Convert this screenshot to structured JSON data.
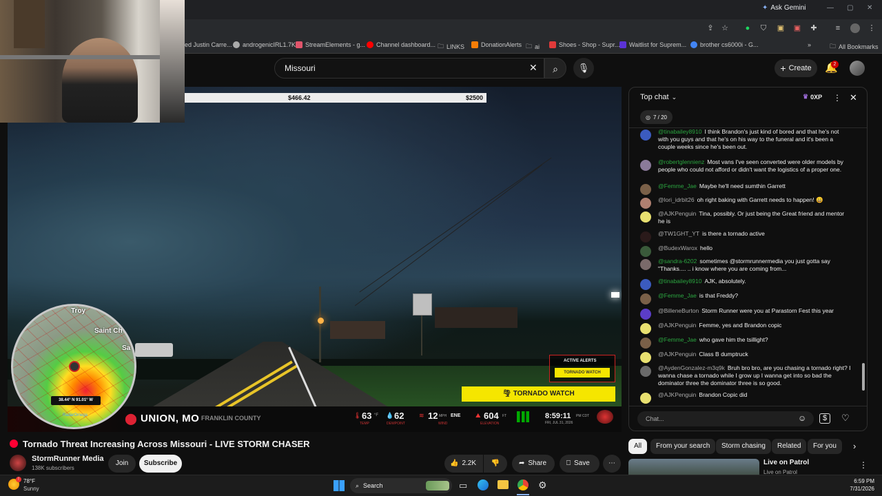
{
  "browser": {
    "ask_gemini": "Ask Gemini",
    "bookmarks": [
      {
        "label": "ed Justin Carre...",
        "color": "#888"
      },
      {
        "label": "androgenicIRL1.7K",
        "color": "#aaa"
      },
      {
        "label": "StreamElements - g...",
        "color": "#e0556b"
      },
      {
        "label": "Channel dashboard...",
        "color": "#ff0000"
      },
      {
        "label": "LINKS",
        "color": "#c8c8c8"
      },
      {
        "label": "DonationAlerts",
        "color": "#f57d07"
      },
      {
        "label": "ai",
        "color": "#c8c8c8"
      },
      {
        "label": "Shoes - Shop - Supr...",
        "color": "#e03a3a"
      },
      {
        "label": "Waitlist for Suprem...",
        "color": "#5b33d6"
      },
      {
        "label": "brother cs6000i - G...",
        "color": "#4285f4"
      }
    ],
    "all_bookmarks": "All Bookmarks"
  },
  "youtube": {
    "search_value": "Missouri",
    "create_label": "Create",
    "notif_count": "2"
  },
  "video": {
    "donation_current": "$466.42",
    "donation_goal": "$2500",
    "location": "UNION, MO",
    "county": "FRANKLIN COUNTY",
    "temp": "63",
    "temp_unit": "°F",
    "temp_label": "TEMP",
    "dewpoint": "62",
    "dewpoint_label": "DEWPOINT",
    "wind": "12",
    "wind_unit": "MPH",
    "wind_dir": "ENE",
    "wind_label": "WIND",
    "elevation": "604",
    "elevation_unit": "FT",
    "elevation_label": "ELEVATION",
    "time": "8:59:11",
    "time_zone": "PM CDT",
    "date": "FRI, JUL 31, 2026",
    "active_alerts": "ACTIVE ALERTS",
    "alert_small": "TORNADO WATCH",
    "alert_banner": "TORNADO WATCH",
    "radar_coords": "38.44° N 91.01° W",
    "radar_brand": "RadarOmega",
    "radar_town1": "Troy",
    "radar_town2": "Saint Ch",
    "radar_town3": "Sa"
  },
  "video_info": {
    "title": "Tornado Threat Increasing Across Missouri - LIVE STORM CHASER",
    "channel": "StormRunner Media",
    "subscribers": "138K subscribers",
    "join": "Join",
    "subscribe": "Subscribe",
    "likes": "2.2K",
    "share": "Share",
    "save": "Save"
  },
  "chat": {
    "header": "Top chat",
    "xp": "0XP",
    "progress": "7 / 20",
    "input_placeholder": "Chat...",
    "messages": [
      {
        "author": "@tinabailey8910",
        "text": "I think Brandon's just kind of bored and that he's not with you guys and that he's on his way to the funeral and it's been a couple weeks since he's been out.",
        "green": true,
        "avatar": "#3b5bbf"
      },
      {
        "author": "@robertglennienz",
        "text": "Most vans I've seen converted were older models by people who could not afford or didn't want the logistics of a proper one.",
        "green": true,
        "avatar": "#8a7a9a"
      },
      {
        "author": "@Femme_Jae",
        "text": "Maybe he'll need sumthin Garrett",
        "green": true,
        "avatar": "#7a6048"
      },
      {
        "author": "@lori_idrbit26",
        "text": "oh right baking with Garrett needs to happen! 😄",
        "green": false,
        "avatar": "#b08070"
      },
      {
        "author": "@AJKPenguin",
        "text": "Tina, possibly. Or just being the Great friend and mentor he is",
        "green": false,
        "avatar": "#e8e070"
      },
      {
        "author": "@TW1GHT_YT",
        "text": "is there a tornado active",
        "green": false,
        "avatar": "#2a1a1a"
      },
      {
        "author": "@BudexWarox",
        "text": "hello",
        "green": false,
        "avatar": "#3a5a3a"
      },
      {
        "author": "@sandra-6202",
        "text": "sometimes @stormrunnermedia you just gotta say \"Thanks.... .. i know where you are coming from...",
        "green": true,
        "avatar": "#7a6a6a"
      },
      {
        "author": "@tinabailey8910",
        "text": "AJK, absolutely.",
        "green": true,
        "avatar": "#3b5bbf"
      },
      {
        "author": "@Femme_Jae",
        "text": "is that Freddy?",
        "green": true,
        "avatar": "#7a6048"
      },
      {
        "author": "@BilleneBurton",
        "text": "Storm Runner were you at Parastorn Fest this year",
        "green": false,
        "avatar": "#5b3dc8"
      },
      {
        "author": "@AJKPenguin",
        "text": "Femme, yes and Brandon copic",
        "green": false,
        "avatar": "#e8e070"
      },
      {
        "author": "@Femme_Jae",
        "text": "who gave him the tsillight?",
        "green": true,
        "avatar": "#7a6048"
      },
      {
        "author": "@AJKPenguin",
        "text": "Class B dumptruck",
        "green": false,
        "avatar": "#e8e070"
      },
      {
        "author": "@AydenGonzalez-m3q9k",
        "text": "Bruh bro bro, are you chasing a tornado right? I wanna chase a tornado while I grow up I wanna get into so bad the dominator three the dominator three is so good.",
        "green": false,
        "avatar": "#6a6a6a"
      },
      {
        "author": "@AJKPenguin",
        "text": "Brandon Copic did",
        "green": false,
        "avatar": "#e8e070"
      }
    ]
  },
  "chips": [
    "All",
    "From your search",
    "Storm chasing",
    "Related",
    "For you"
  ],
  "recommended": {
    "title": "Live on Patrol",
    "subtitle": "Live on Patrol"
  },
  "taskbar": {
    "weather_temp": "78°F",
    "weather_desc": "Sunny",
    "search_label": "Search",
    "time": "6:59 PM",
    "date": "7/31/2026"
  }
}
